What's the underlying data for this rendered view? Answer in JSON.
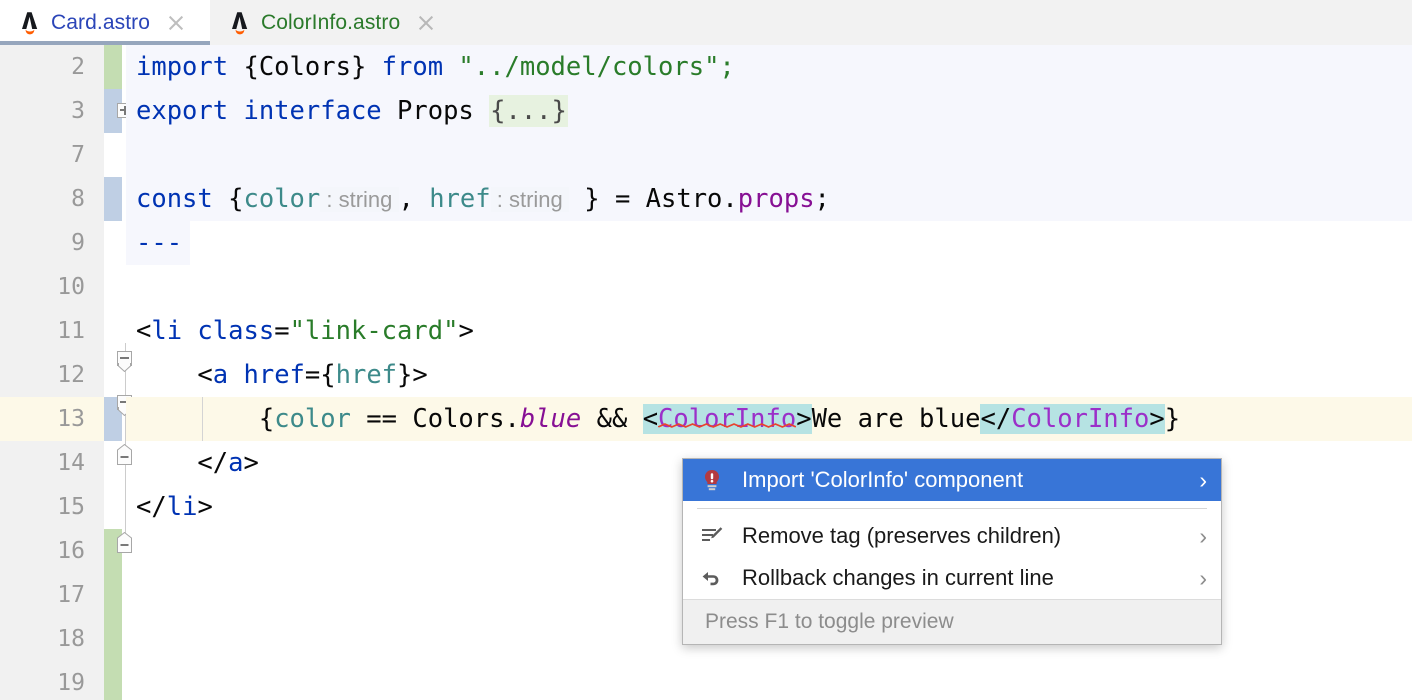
{
  "tabs": [
    {
      "label": "Card.astro",
      "icon": "astro-icon",
      "active": true,
      "color": "blue",
      "close_icon": "close-icon"
    },
    {
      "label": "ColorInfo.astro",
      "icon": "astro-icon",
      "active": false,
      "color": "green",
      "close_icon": "close-icon"
    }
  ],
  "editor": {
    "line_numbers": [
      "2",
      "3",
      "7",
      "8",
      "9",
      "10",
      "11",
      "12",
      "13",
      "14",
      "15",
      "16",
      "17",
      "18",
      "19"
    ],
    "current_line_number": "13",
    "lines": {
      "l2": {
        "kw_import": "import",
        "braces": " {Colors} ",
        "kw_from": "from",
        "path": " \"../model/colors\";"
      },
      "l3": {
        "kw_export": "export",
        "kw_interface": " interface",
        "name": " Props ",
        "fold": "{...}"
      },
      "l7": {
        "text": ""
      },
      "l8": {
        "kw_const": "const",
        "open": " {",
        "p1": "color",
        "hint1": " : string ",
        "comma": ", ",
        "p2": "href",
        "hint2": " : string ",
        "close": " } = Astro.",
        "prop": "props",
        "semi": ";"
      },
      "l9": {
        "dashes": "---"
      },
      "l10": {
        "text": ""
      },
      "l11": {
        "lt": "<",
        "tag": "li",
        "attr": " class",
        "eq": "=",
        "val": "\"link-card\"",
        "gt": ">"
      },
      "l12": {
        "indent": "    ",
        "lt": "<",
        "tag": "a",
        "attr": " href",
        "eq": "=",
        "brace_open": "{",
        "val": "href",
        "brace_close": "}",
        "gt": ">"
      },
      "l13": {
        "indent": "        ",
        "brace": "{",
        "var": "color",
        "op": " == ",
        "obj": "Colors.",
        "member": "blue",
        "and": " && ",
        "open_lt": "<",
        "open_tag": "ColorInfo",
        "open_gt": ">",
        "text": "We are blue",
        "close_lt": "</",
        "close_tag": "ColorInfo",
        "close_gt": ">",
        "brace_end": "}"
      },
      "l14": {
        "indent": "    ",
        "lt": "</",
        "tag": "a",
        "gt": ">"
      },
      "l15": {
        "lt": "</",
        "tag": "li",
        "gt": ">"
      },
      "l16": {
        "text": ""
      },
      "l17": {
        "text": ""
      },
      "l18": {
        "text": ""
      },
      "l19": {
        "text": ""
      }
    },
    "gutter": {
      "change_markers": [
        {
          "line": "2",
          "type": "green"
        },
        {
          "line": "3",
          "type": "blue"
        },
        {
          "line": "8",
          "type": "blue"
        },
        {
          "line": "13",
          "type": "blue"
        },
        {
          "line": "16",
          "type": "green"
        }
      ],
      "fold_markers": [
        {
          "line": "3",
          "state": "collapsed",
          "icon": "expand-plus-icon"
        },
        {
          "line": "11",
          "state": "expanded",
          "icon": "collapse-minus-icon"
        },
        {
          "line": "12",
          "state": "expanded",
          "icon": "collapse-minus-icon"
        },
        {
          "line": "14",
          "state": "expanded",
          "icon": "collapse-minus-icon"
        },
        {
          "line": "15",
          "state": "expanded",
          "icon": "collapse-minus-icon"
        }
      ]
    }
  },
  "popup": {
    "items": [
      {
        "label": "Import 'ColorInfo' component",
        "icon": "lightbulb-error-icon",
        "selected": true,
        "chevron": "›"
      },
      {
        "label": "Remove tag (preserves children)",
        "icon": "edit-lines-icon",
        "selected": false,
        "chevron": "›"
      },
      {
        "label": "Rollback changes in current line",
        "icon": "rollback-arrow-icon",
        "selected": false,
        "chevron": "›"
      }
    ],
    "footer": "Press F1 to toggle preview"
  },
  "colors": {
    "selection_blue": "#3875d7",
    "tag_highlight": "#b6e3e3",
    "current_line": "#fdf9e8",
    "frontmatter_bg": "#f6f7fd",
    "keyword": "#0033b3",
    "string": "#2a7c2a",
    "component": "#9b30c9",
    "change_green": "#c4ddb2",
    "change_blue": "#bfcfe4"
  }
}
